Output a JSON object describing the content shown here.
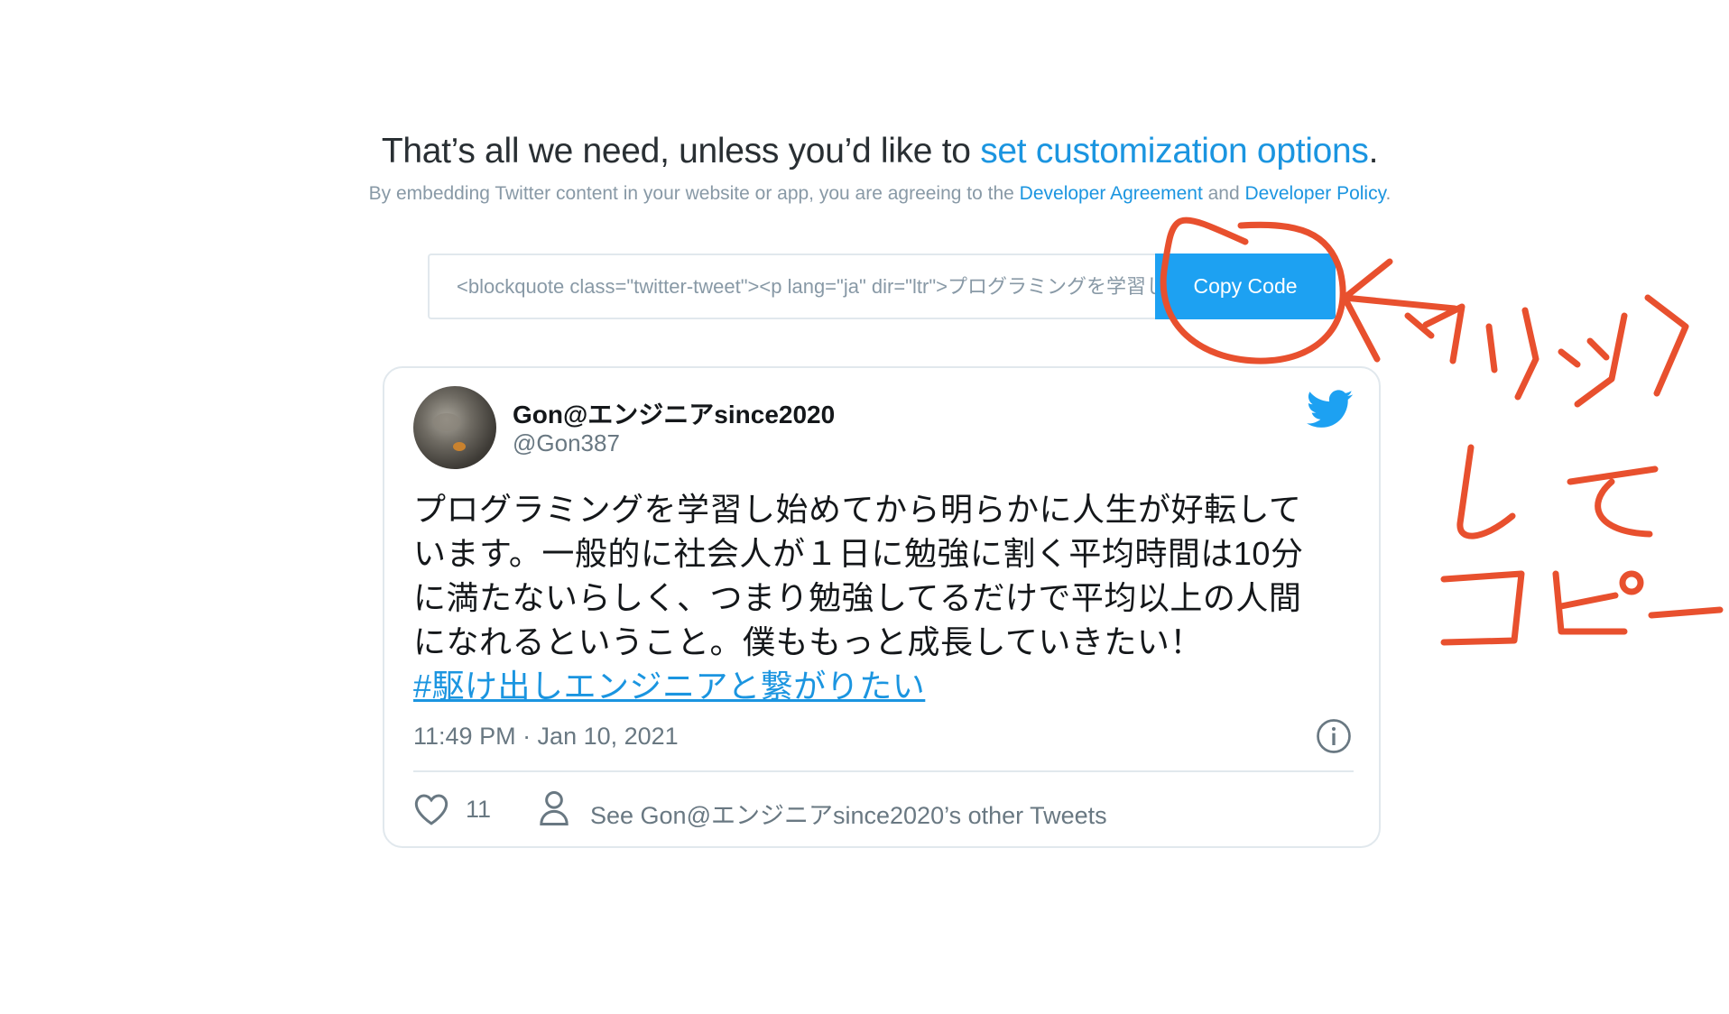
{
  "header": {
    "headline_prefix": "That’s all we need, unless you’d like to ",
    "headline_link": "set customization options",
    "headline_suffix": ".",
    "sub_prefix": "By embedding Twitter content in your website or app, you are agreeing to the ",
    "sub_link1": "Developer Agreement",
    "sub_middle": " and ",
    "sub_link2": "Developer Policy",
    "sub_suffix": "."
  },
  "embed": {
    "code_value": "<blockquote class=\"twitter-tweet\"><p lang=\"ja\" dir=\"ltr\">プログラミングを学習し始めてから",
    "copy_button_label": "Copy Code"
  },
  "tweet": {
    "display_name": "Gon@エンジニアsince2020",
    "handle": "@Gon387",
    "text_lines": [
      "プログラミングを学習し始めてから明らかに人生が好転して",
      "います。一般的に社会人が１日に勉強に割く平均時間は10分",
      "に満たないらしく、つまり勉強してるだけで平均以上の人間",
      "になれるということ。僕ももっと成長していきたい！"
    ],
    "hashtag": "#駆け出しエンジニアと繋がりたい",
    "timestamp": "11:49 PM · Jan 10, 2021",
    "like_count": "11",
    "see_more_label": "See Gon@エンジニアsince2020’s other Tweets"
  },
  "annotation": {
    "lines": [
      "クリック",
      "して",
      "コピー"
    ],
    "color": "#e8502e"
  },
  "colors": {
    "accent": "#1da1f2",
    "link": "#1b95e0",
    "muted": "#697882"
  },
  "icons": [
    "twitter-bird-icon",
    "info-icon",
    "heart-icon",
    "person-icon",
    "arrow-icon"
  ]
}
